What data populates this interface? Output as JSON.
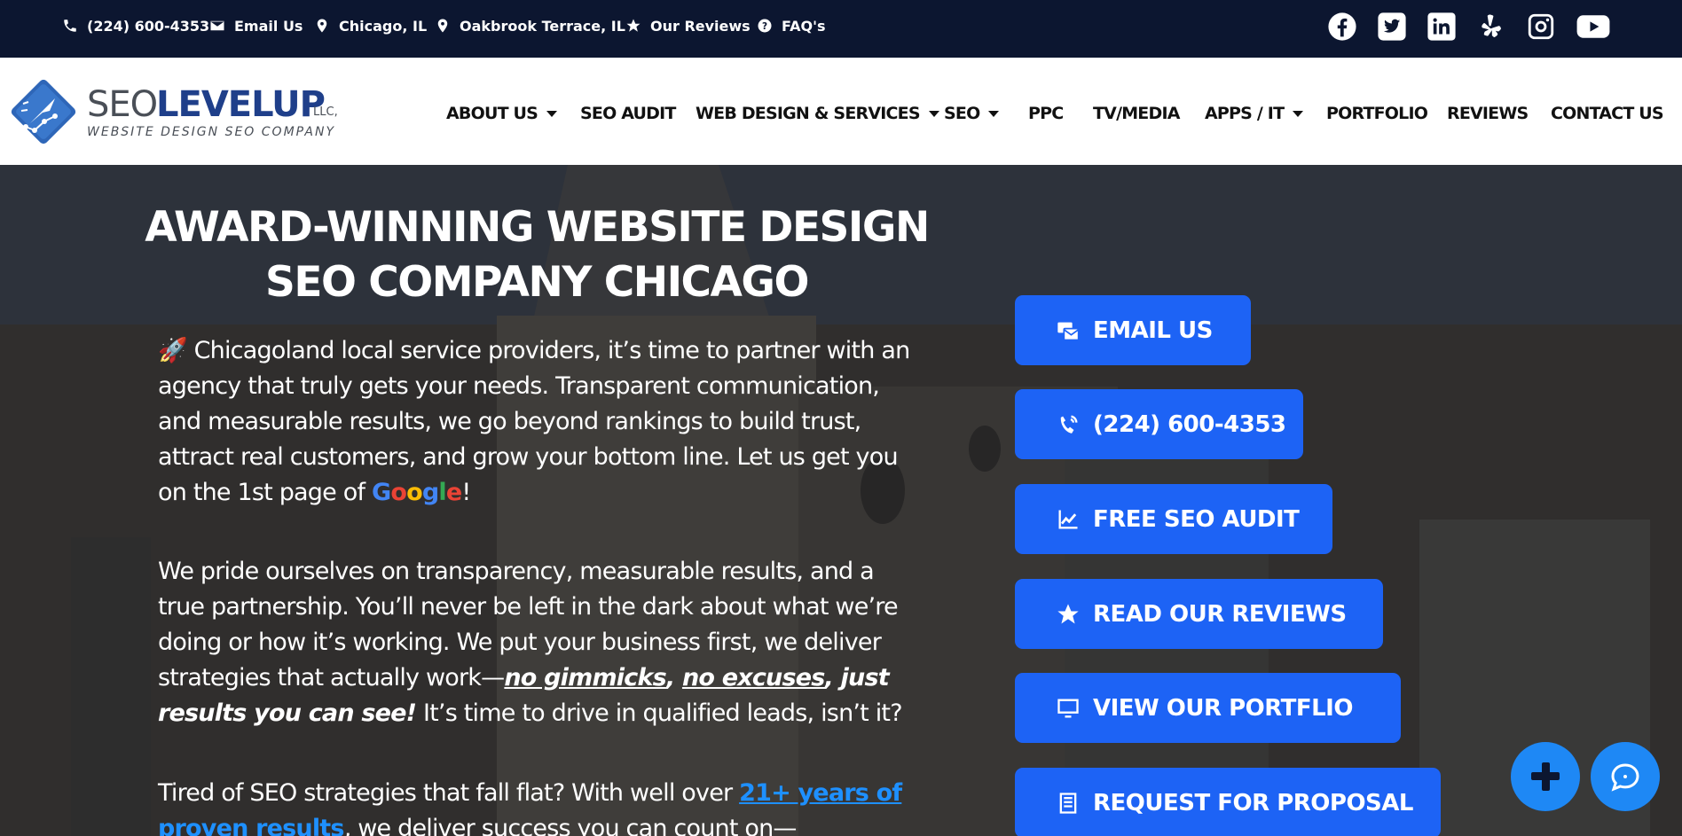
{
  "topbar": {
    "phone": "(224) 600-4353",
    "email": "Email Us",
    "location1": "Chicago, IL",
    "location2": "Oakbrook Terrace, IL",
    "reviews": "Our Reviews",
    "faqs": "FAQ's",
    "social_icons": [
      "facebook-icon",
      "twitter-icon",
      "linkedin-icon",
      "yelp-icon",
      "instagram-icon",
      "youtube-icon"
    ]
  },
  "logo": {
    "seo": "SEO",
    "levelup": "LEVELUP",
    "llc": "LLC,",
    "tagline": "WEBSITE DESIGN SEO COMPANY"
  },
  "nav": {
    "about": "ABOUT US",
    "seo_audit": "SEO AUDIT",
    "web_design": "WEB DESIGN & SERVICES",
    "seo": "SEO",
    "ppc": "PPC",
    "tv_media": "TV/MEDIA",
    "apps_it": "APPS / IT",
    "portfolio": "PORTFOLIO",
    "reviews": "REVIEWS",
    "contact": "CONTACT US"
  },
  "hero": {
    "title_line1": "AWARD-WINNING WEBSITE DESIGN",
    "title_line2": "SEO COMPANY CHICAGO",
    "p1_emoji": "🚀",
    "p1_text": " Chicagoland local service providers, it’s time to partner with an agency that truly gets your needs.  Transparent communication, and measurable results, we go beyond rankings to build trust, attract real customers, and grow your bottom line. Let us get you on the 1st page of ",
    "google": [
      "G",
      "o",
      "o",
      "g",
      "l",
      "e"
    ],
    "p1_end": "!",
    "p2_text": "We pride ourselves on transparency, measurable results, and a true partnership. You’ll never be left in the dark about what we’re doing or how it’s working. We put your business first, we deliver strategies that actually work—",
    "p2_em1": "no gimmicks",
    "p2_comma": ", ",
    "p2_em2": "no excuses",
    "p2_em3": ", just results you can see!",
    "p2_end": " It’s time to drive in qualified leads, isn’t it?",
    "p3_text": "Tired of SEO strategies that fall flat? With well over ",
    "p3_link": "21+ years of proven results",
    "p3_end": ", we deliver success you can count on—"
  },
  "cta": {
    "email": "EMAIL US",
    "phone": "(224) 600-4353",
    "audit": "FREE SEO AUDIT",
    "reviews": "READ OUR REVIEWS",
    "portfolio": "VIEW OUR PORTFLIO",
    "proposal": "REQUEST FOR PROPOSAL"
  },
  "colors": {
    "topbar_bg": "#0c1630",
    "cta_blue": "#1d63f5",
    "link_blue": "#1e90ff",
    "fab_blue": "#1e88f5"
  }
}
